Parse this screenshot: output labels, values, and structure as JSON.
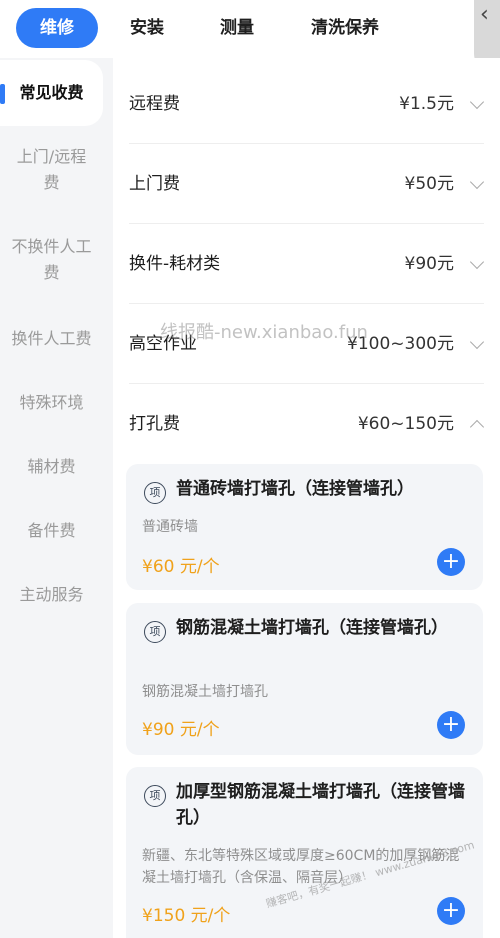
{
  "tabs": [
    {
      "label": "维修",
      "active": true
    },
    {
      "label": "安装",
      "active": false
    },
    {
      "label": "测量",
      "active": false
    },
    {
      "label": "清洗保养",
      "active": false
    }
  ],
  "sidebar": [
    {
      "label": "常见收费",
      "active": true
    },
    {
      "label": "上门/远程费"
    },
    {
      "label": "不换件人工费"
    },
    {
      "label": "换件人工费"
    },
    {
      "label": "特殊环境"
    },
    {
      "label": "辅材费"
    },
    {
      "label": "备件费"
    },
    {
      "label": "主动服务"
    }
  ],
  "fees": [
    {
      "label": "远程费",
      "price": "¥1.5元",
      "expanded": false
    },
    {
      "label": "上门费",
      "price": "¥50元",
      "expanded": false
    },
    {
      "label": "换件-耗材类",
      "price": "¥90元",
      "expanded": false
    },
    {
      "label": "高空作业",
      "price": "¥100~300元",
      "expanded": false
    },
    {
      "label": "打孔费",
      "price": "¥60~150元",
      "expanded": true
    }
  ],
  "items": [
    {
      "badge": "项",
      "title": "普通砖墙打墙孔（连接管墙孔）",
      "desc": "普通砖墙",
      "price": "¥60 元/个"
    },
    {
      "badge": "项",
      "title": "钢筋混凝土墙打墙孔（连接管墙孔）",
      "desc": "钢筋混凝土墙打墙孔",
      "price": "¥90 元/个"
    },
    {
      "badge": "项",
      "title": "加厚型钢筋混凝土墙打墙孔（连接管墙孔）",
      "desc": "新疆、东北等特殊区域或厚度≥60CM的加厚钢筋混凝土墙打墙孔（含保温、隔音层）",
      "price": "¥150 元/个"
    }
  ],
  "watermark": "线报酷-new.xianbao.fun",
  "watermark2": "赚客吧，有奖一起赚！ www.zuanke8.com",
  "colors": {
    "accent": "#2f7bf6",
    "price": "#f0a21b"
  }
}
